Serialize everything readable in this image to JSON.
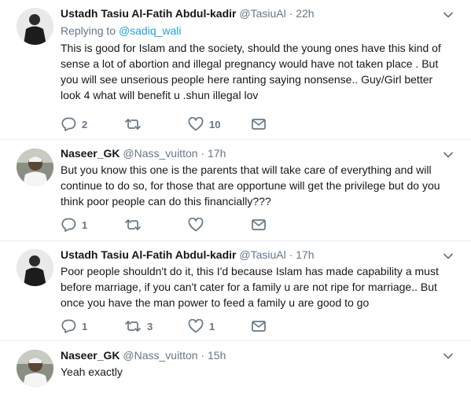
{
  "tweets": [
    {
      "name": "Ustadh Tasiu Al-Fatih Abdul-kadir",
      "handle": "@TasiuAl",
      "dot": "·",
      "time": "22h",
      "replying_prefix": "Replying to ",
      "replying_to": "@sadiq_wali",
      "text": "This is good for Islam and the society, should the young ones have this kind of sense a lot of abortion and illegal pregnancy would have not taken place . But you will see unserious people here ranting saying nonsense.. Guy/Girl better look 4 what will benefit u .shun illegal lov",
      "replies": "2",
      "retweets": "",
      "likes": "10"
    },
    {
      "name": "Naseer_GK",
      "handle": "@Nass_vuitton",
      "dot": "·",
      "time": "17h",
      "text": "But you know this one is the parents that will take care of everything and will continue to do so, for those that are opportune will get the privilege but do you think poor people can do this financially???",
      "replies": "1",
      "retweets": "",
      "likes": ""
    },
    {
      "name": "Ustadh Tasiu Al-Fatih Abdul-kadir",
      "handle": "@TasiuAl",
      "dot": "·",
      "time": "17h",
      "text": "Poor people shouldn't do it, this I'd because Islam has made capability a must before marriage, if you can't cater for a family u are not ripe for marriage.. But once you have the man power to feed a family u are good to go",
      "replies": "1",
      "retweets": "3",
      "likes": "1"
    },
    {
      "name": "Naseer_GK",
      "handle": "@Nass_vuitton",
      "dot": "·",
      "time": "15h",
      "text": "Yeah exactly"
    }
  ],
  "colors": {
    "text": "#14171a",
    "muted": "#657786",
    "link": "#1da1f2",
    "divider": "#e6ecf0"
  },
  "icons": {
    "reply": "reply-icon",
    "retweet": "retweet-icon",
    "like": "heart-icon",
    "dm": "envelope-icon",
    "more": "chevron-down-icon"
  }
}
